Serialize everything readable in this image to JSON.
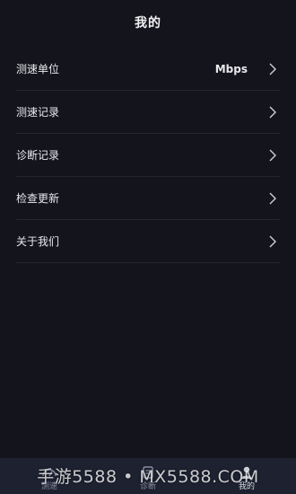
{
  "header": {
    "title": "我的"
  },
  "menu": {
    "items": [
      {
        "label": "测速单位",
        "value": "Mbps"
      },
      {
        "label": "测速记录"
      },
      {
        "label": "诊断记录"
      },
      {
        "label": "检查更新"
      },
      {
        "label": "关于我们"
      }
    ]
  },
  "tabbar": {
    "tabs": [
      {
        "label": "测速",
        "icon": "speed-test-icon",
        "active": false
      },
      {
        "label": "诊断",
        "icon": "diagnose-icon",
        "active": false
      },
      {
        "label": "我的",
        "icon": "profile-icon",
        "active": true
      }
    ]
  },
  "watermark": {
    "text": "手游5588 • MX5588.COM"
  },
  "colors": {
    "background": "#14141c",
    "divider": "#262630",
    "tabbar": "#1d2130"
  }
}
